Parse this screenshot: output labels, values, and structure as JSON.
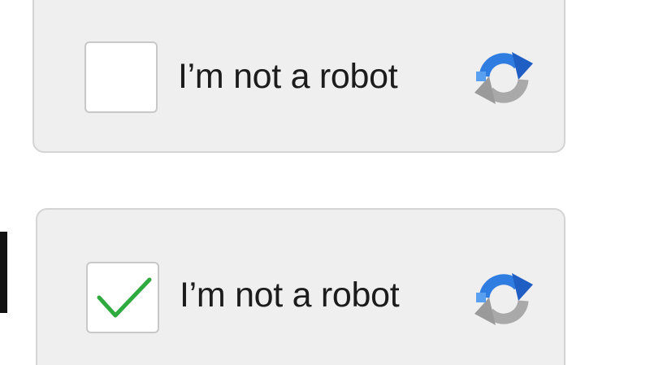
{
  "widgets": [
    {
      "state": "unchecked",
      "checked": false,
      "label": "I’m not a robot",
      "logo_icon": "recaptcha-logo-icon"
    },
    {
      "state": "checked",
      "checked": true,
      "label": "I’m not a robot",
      "checkmark_icon": "checkmark-icon",
      "logo_icon": "recaptcha-logo-icon"
    }
  ],
  "colors": {
    "card_background": "#efefef",
    "card_border": "#d4d4d4",
    "checkbox_background": "#ffffff",
    "checkmark": "#2eaa3f",
    "logo_blue": "#2f7de1",
    "logo_gray": "#a9a9a9",
    "label_text": "#1c1c1c"
  }
}
